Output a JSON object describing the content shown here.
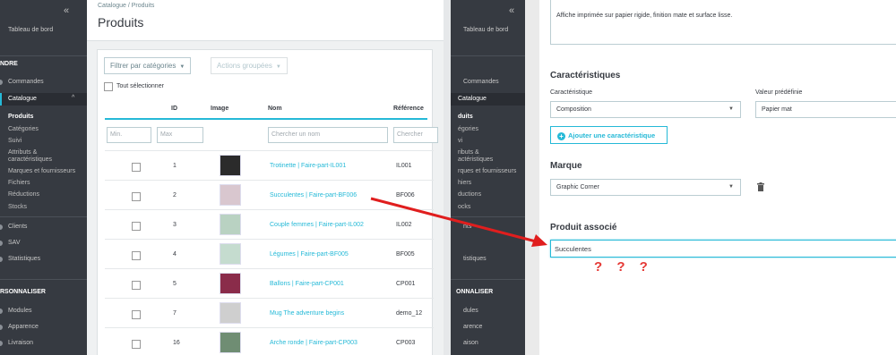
{
  "sidebar_left": {
    "collapse": "«",
    "dashboard": "Tableau de bord",
    "sell_header": "NDRE",
    "orders": "Commandes",
    "catalog": "Catalogue",
    "catalog_items": [
      "Produits",
      "Catégories",
      "Suivi",
      "Attributs &",
      "caractéristiques",
      "Marques et fournisseurs",
      "Fichiers",
      "Réductions",
      "Stocks"
    ],
    "clients": "Clients",
    "sav": "SAV",
    "stats": "Statistiques",
    "custom_header": "RSONNALISER",
    "modules": "Modules",
    "appearance": "Apparence",
    "shipping": "Livraison"
  },
  "sidebar_right": {
    "collapse": "«",
    "dashboard": "Tableau de bord",
    "orders": "Commandes",
    "catalog": "Catalogue",
    "catalog_items": [
      "duits",
      "égories",
      "vi",
      "ributs &",
      "actéristiques",
      "rques et fournisseurs",
      "hiers",
      "ductions",
      "ocks"
    ],
    "clients": "nts",
    "stats": "tistiques",
    "custom_header": "ONNALISER",
    "modules": "dules",
    "appearance": "arence",
    "shipping": "aison"
  },
  "products_page": {
    "breadcrumb": "Catalogue  /  Produits",
    "title": "Produits",
    "filter_categories": "Filtrer par catégories",
    "bulk_actions": "Actions groupées",
    "select_all": "Tout sélectionner",
    "columns": {
      "id": "ID",
      "image": "Image",
      "name": "Nom",
      "reference": "Référence"
    },
    "filters": {
      "min": "Min.",
      "max": "Max",
      "name": "Chercher un nom",
      "reference": "Chercher"
    },
    "rows": [
      {
        "id": "1",
        "name": "Trotinette | Faire-part-IL001",
        "ref": "IL001",
        "thumb": "#2b2b2b"
      },
      {
        "id": "2",
        "name": "Succulentes | Faire-part-BF006",
        "ref": "BF006",
        "thumb": "#d9c7cf"
      },
      {
        "id": "3",
        "name": "Couple femmes | Faire-part-IL002",
        "ref": "IL002",
        "thumb": "#b9d2c2"
      },
      {
        "id": "4",
        "name": "Légumes | Faire-part-BF005",
        "ref": "BF005",
        "thumb": "#c5dccf"
      },
      {
        "id": "5",
        "name": "Ballons | Faire-part-CP001",
        "ref": "CP001",
        "thumb": "#8a2c4a"
      },
      {
        "id": "7",
        "name": "Mug The adventure begins",
        "ref": "demo_12",
        "thumb": "#cfcfcf"
      },
      {
        "id": "16",
        "name": "Arche ronde | Faire-part-CP003",
        "ref": "CP003",
        "thumb": "#6f8d73"
      }
    ]
  },
  "product_edit": {
    "description": "Affiche imprimée sur papier rigide, finition mate et surface lisse.",
    "features_title": "Caractéristiques",
    "feature_label": "Caractéristique",
    "preset_label": "Valeur prédéfinie",
    "feature_value": "Composition",
    "preset_value": "Papier mat",
    "add_feature": "Ajouter une caractéristique",
    "brand_title": "Marque",
    "brand_value": "Graphic Corner",
    "related_title": "Produit associé",
    "related_value": "Succulentes",
    "annotation": "? ? ?"
  },
  "colors": {
    "accent": "#25b9d7",
    "sidebar": "#363a41",
    "arrow": "#e01e1e"
  }
}
